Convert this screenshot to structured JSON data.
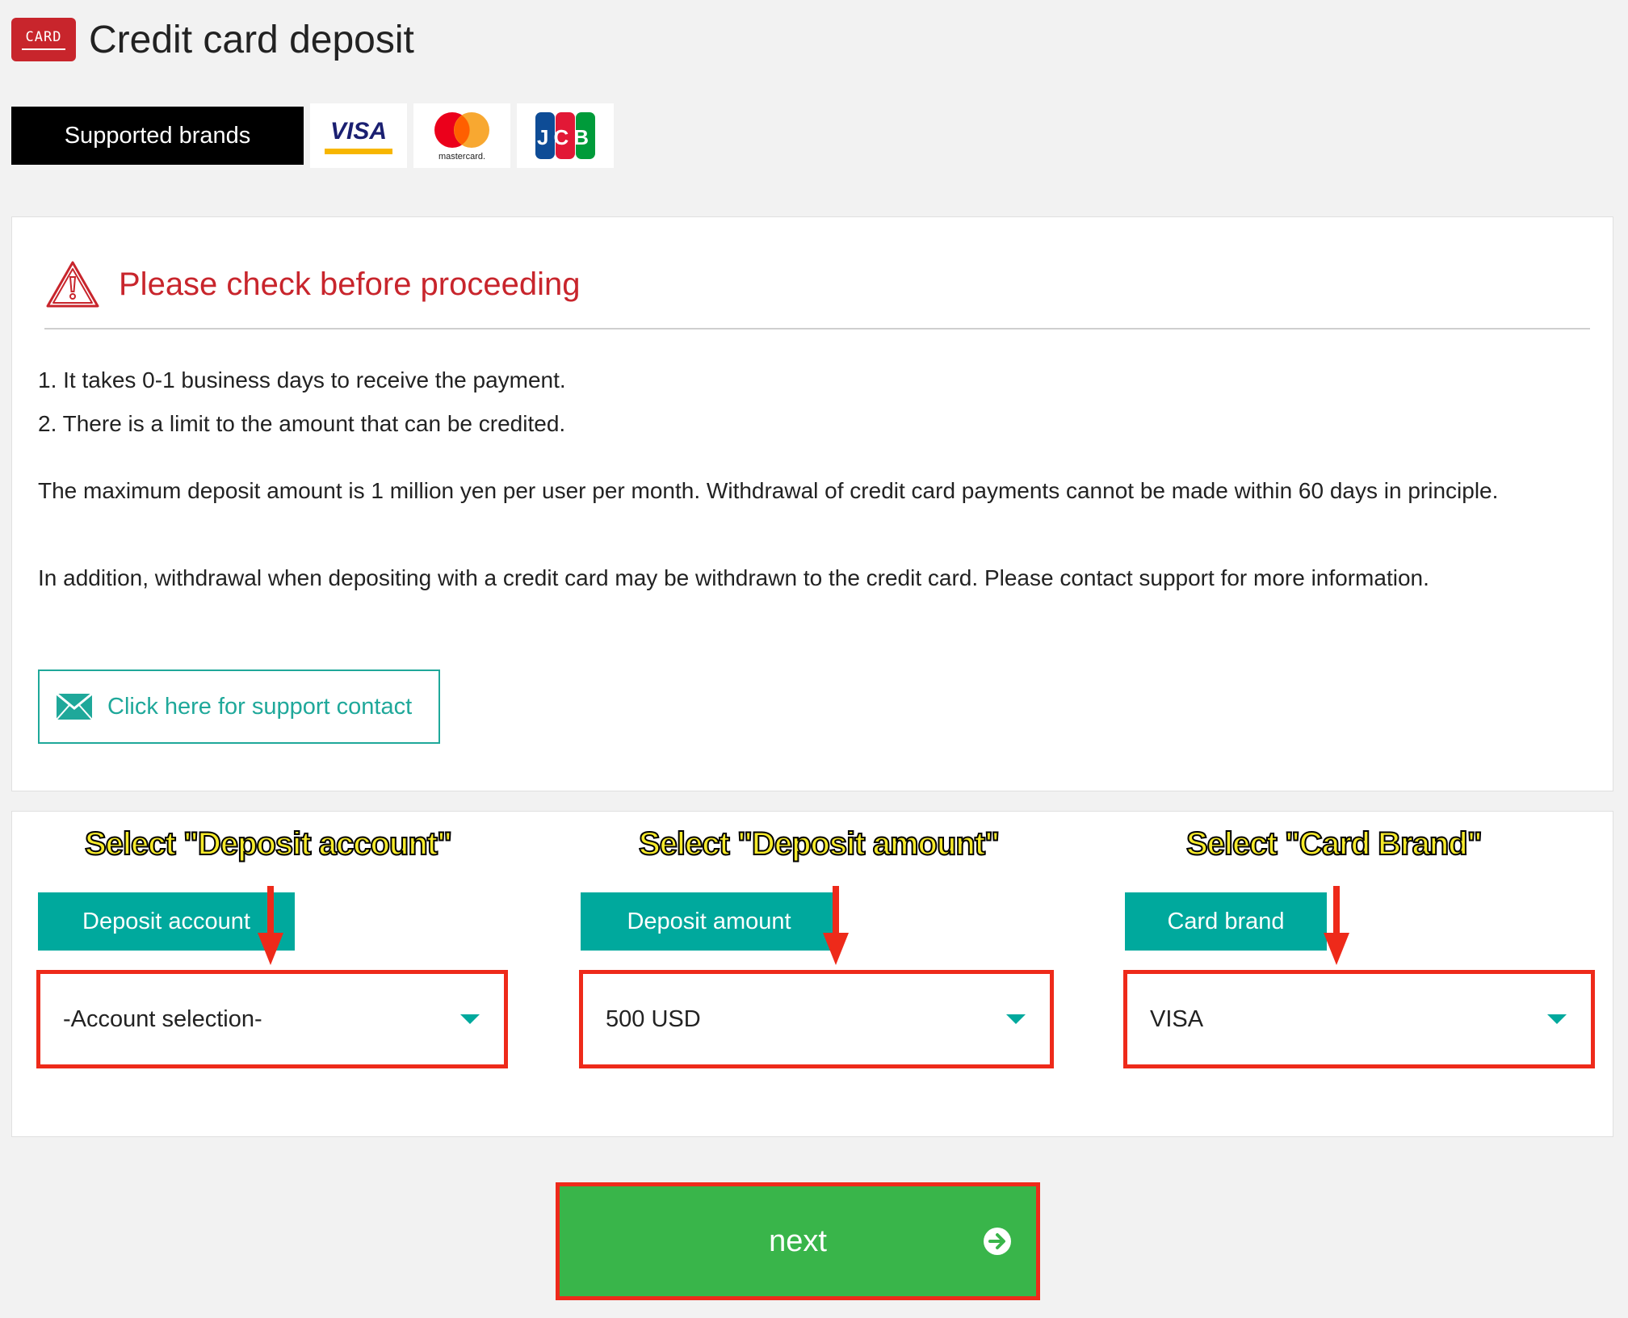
{
  "header": {
    "badge_text": "CARD",
    "title": "Credit card deposit"
  },
  "brands": {
    "label": "Supported brands",
    "items": [
      {
        "name": "visa-logo",
        "text": "VISA"
      },
      {
        "name": "mastercard-logo",
        "text": "mastercard."
      },
      {
        "name": "jcb-logo",
        "text": "JCB"
      }
    ]
  },
  "notice": {
    "title": "Please check before proceeding",
    "items": [
      "1. It takes 0-1 business days to receive the payment.",
      "2. There is a limit to the amount that can be credited."
    ],
    "paragraph1": "The maximum deposit amount is 1 million yen per user per month. Withdrawal of credit card payments cannot be made within 60 days in principle.",
    "paragraph2": "In addition, withdrawal when depositing with a credit card may be withdrawn to the credit card. Please contact support for more information.",
    "support_button": "Click here for support contact"
  },
  "form": {
    "fields": [
      {
        "annotation": "Select \"Deposit account\"",
        "label": "Deposit account",
        "value": "-Account selection-"
      },
      {
        "annotation": "Select \"Deposit amount\"",
        "label": "Deposit amount",
        "value": "500 USD"
      },
      {
        "annotation": "Select \"Card Brand\"",
        "label": "Card brand",
        "value": "VISA"
      }
    ]
  },
  "next_button": "next",
  "colors": {
    "accent_teal": "#00a99d",
    "alert_red": "#c8252c",
    "highlight_red": "#ee2a1a",
    "next_green": "#39b54a",
    "annotation_yellow": "#f6ea2b"
  }
}
